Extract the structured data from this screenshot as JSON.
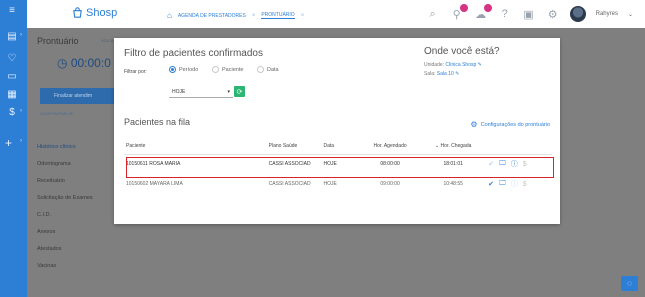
{
  "colors": {
    "brand": "#2d7fd6",
    "highlight": "#d9232a",
    "refresh": "#2bb673"
  },
  "topbar": {
    "logo_text": "Shosp",
    "breadcrumbs": [
      "AGENDA DE PRESTADORES",
      "PRONTUÁRIO"
    ],
    "user_name": "Rahyres"
  },
  "background": {
    "title": "Prontuário",
    "back_label": "VOLTAR",
    "timer": "00:00:0",
    "finish_label": "Finalizar atendim",
    "mini_links": "CONFIGURAR   VE",
    "menu": [
      "Histórico clínico",
      "Odontograma",
      "Receituário",
      "Solicitação de Exames",
      "C.I.D.",
      "Anexos",
      "Atestados",
      "Vacinas"
    ]
  },
  "modal": {
    "title": "Filtro de pacientes confirmados",
    "filter_label": "Filtrar por:",
    "filter_options": [
      {
        "label": "Período",
        "selected": true
      },
      {
        "label": "Paciente",
        "selected": false
      },
      {
        "label": "Data",
        "selected": false
      }
    ],
    "period_value": "HOJE",
    "where_title": "Onde você está?",
    "unit_label": "Unidade:",
    "unit_value": "Clínica Shosp",
    "room_label": "Sala:",
    "room_value": "Sala 10",
    "queue_title": "Pacientes na fila",
    "config_label": "Configurações do prontuário",
    "columns": [
      "Paciente",
      "Plano Saúde",
      "Data",
      "Hor. Agendado",
      "Hor. Chegada"
    ],
    "rows": [
      {
        "paciente": "10150611 ROSA MARIA",
        "plano": "CASSI ASSOCIAD",
        "data": "HOJE",
        "agendado": "08:00:00",
        "chegada": "18:01:01",
        "highlighted": true
      },
      {
        "paciente": "10150602 MAYARA LIMA",
        "plano": "CASSI ASSOCIAD",
        "data": "HOJE",
        "agendado": "09:00:00",
        "chegada": "10:48:55",
        "highlighted": false
      }
    ]
  }
}
